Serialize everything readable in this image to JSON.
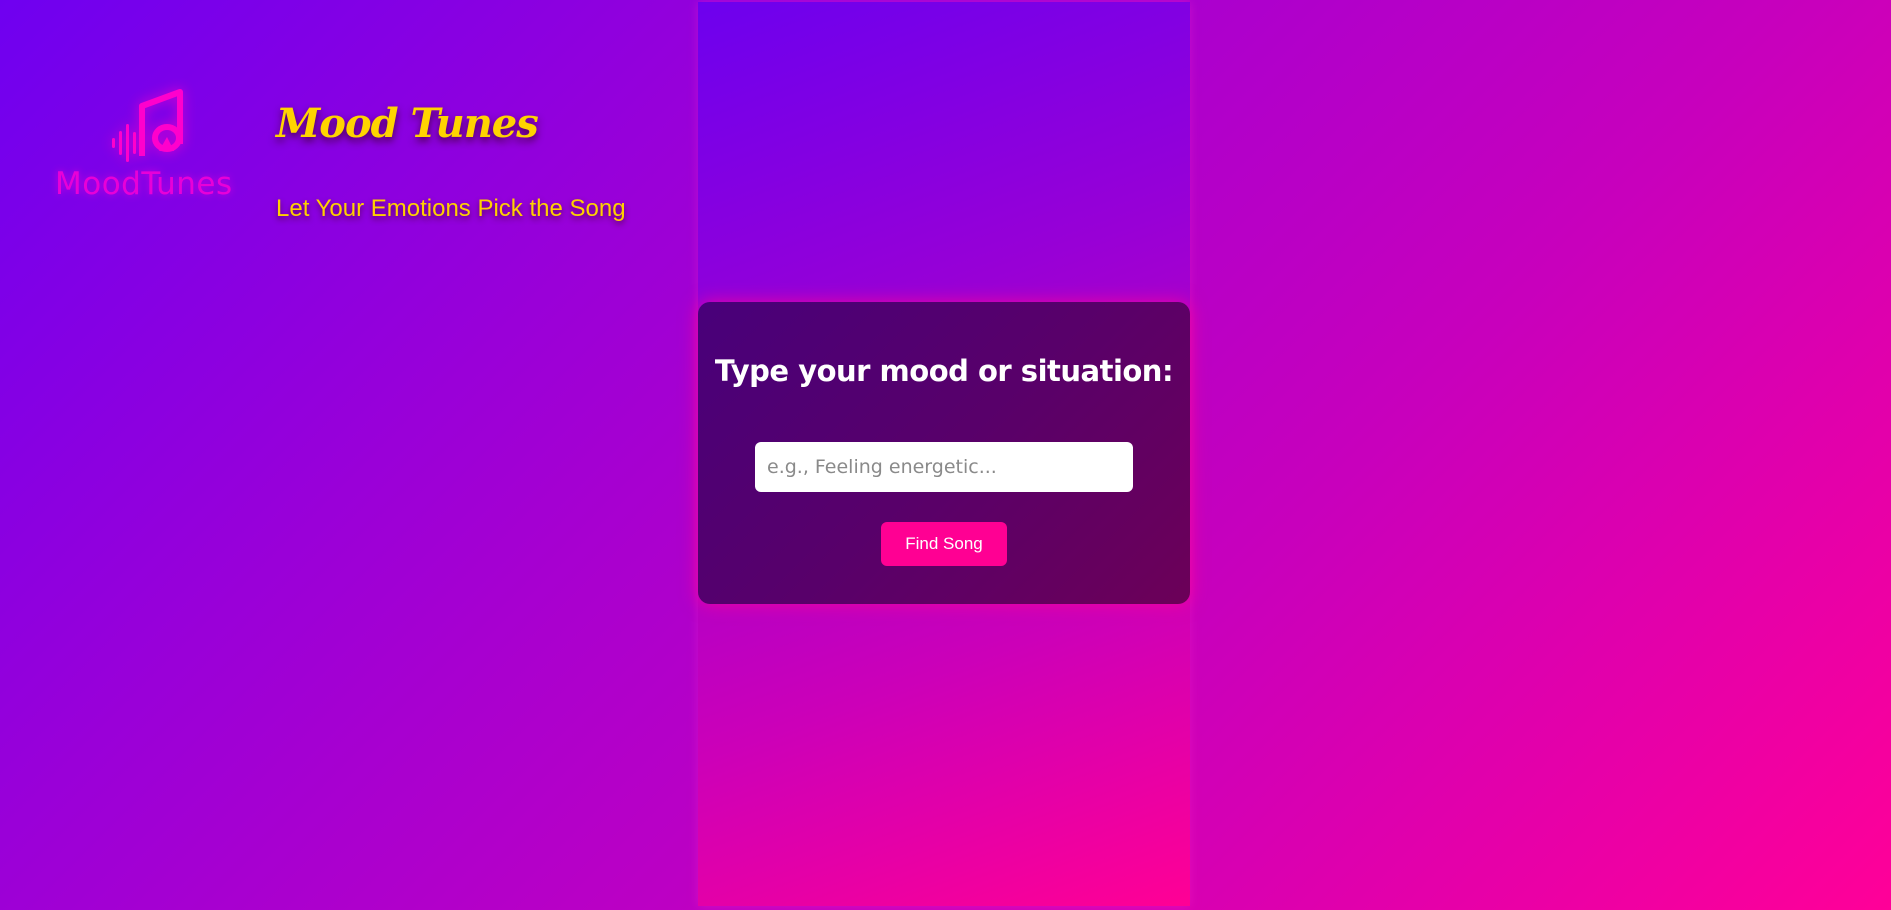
{
  "header": {
    "logo_text": "MoodTunes",
    "title": "Mood Tunes",
    "tagline": "Let Your Emotions Pick the Song"
  },
  "card": {
    "heading": "Type your mood or situation:",
    "input": {
      "value": "",
      "placeholder": "e.g., Feeling energetic..."
    },
    "button_label": "Find Song"
  },
  "colors": {
    "accent_pink": "#ff0093",
    "title_yellow": "#ffd400",
    "logo_magenta": "#e800d8",
    "bg_purple": "#6f00f0",
    "card_dark": "#4a0076"
  },
  "icons": {
    "logo": "music-note-soundwave-icon"
  }
}
